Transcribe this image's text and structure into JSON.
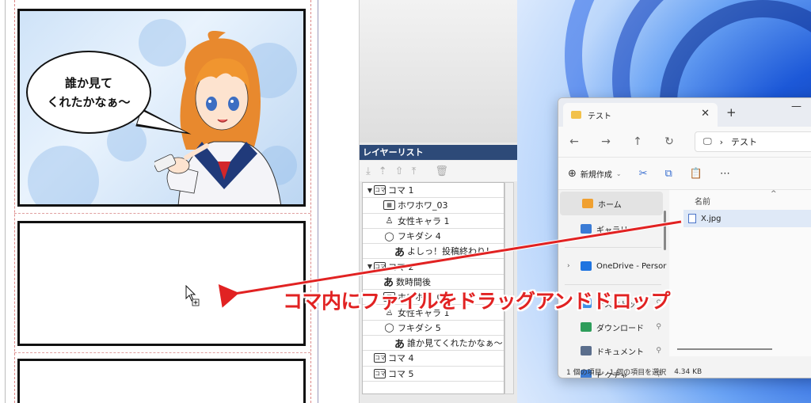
{
  "canvas": {
    "speech_line1": "誰か見て",
    "speech_line2": "くれたかなぁ～"
  },
  "layer_panel": {
    "title": "レイヤーリスト",
    "tool_icons": [
      "download-icon",
      "merge-icon",
      "move-up-icon",
      "move-top-icon",
      "trash-icon"
    ],
    "layers": [
      {
        "level": 1,
        "type": "koma",
        "label": "コマ 1",
        "expanded": true
      },
      {
        "level": 2,
        "type": "image",
        "label": "ホワホワ_03"
      },
      {
        "level": 2,
        "type": "character",
        "label": "女性キャラ 1"
      },
      {
        "level": 2,
        "type": "balloon",
        "label": "フキダシ 4"
      },
      {
        "level": 3,
        "type": "text",
        "label": "よしっ！投稿終わり！"
      },
      {
        "level": 1,
        "type": "koma",
        "label": "コマ 2",
        "expanded": true
      },
      {
        "level": 2,
        "type": "text",
        "label": "数時間後"
      },
      {
        "level": 2,
        "type": "image",
        "label": "ホワホワ_02"
      },
      {
        "level": 2,
        "type": "character",
        "label": "女性キャラ 1"
      },
      {
        "level": 2,
        "type": "balloon",
        "label": "フキダシ 5"
      },
      {
        "level": 3,
        "type": "text",
        "label": "誰か見てくれたかなぁ～"
      },
      {
        "level": 1,
        "type": "koma",
        "label": "コマ 4"
      },
      {
        "level": 1,
        "type": "koma",
        "label": "コマ 5"
      }
    ]
  },
  "explorer": {
    "tab_title": "テスト",
    "address_folder": "テスト",
    "new_label": "新規作成",
    "nav_items": [
      {
        "label": "ホーム",
        "icon": "home-icon",
        "selected": true,
        "pinned": false,
        "chevron": false
      },
      {
        "label": "ギャラリー",
        "icon": "gallery-icon",
        "selected": false,
        "pinned": false,
        "chevron": false
      },
      {
        "label": "OneDrive - Persor",
        "icon": "cloud-icon",
        "selected": false,
        "pinned": false,
        "chevron": true
      },
      {
        "label": "デスクトップ",
        "icon": "desktop-icon",
        "selected": false,
        "pinned": true,
        "chevron": false
      },
      {
        "label": "ダウンロード",
        "icon": "download-icon",
        "selected": false,
        "pinned": true,
        "chevron": false
      },
      {
        "label": "ドキュメント",
        "icon": "document-icon",
        "selected": false,
        "pinned": true,
        "chevron": false
      },
      {
        "label": "ピクチャ",
        "icon": "picture-icon",
        "selected": false,
        "pinned": true,
        "chevron": false
      }
    ],
    "column_name": "名前",
    "file_name": "X.jpg",
    "status_count": "1 個の項目",
    "status_selected": "1 個の項目を選択",
    "status_size": "4.34 KB"
  },
  "annotation": {
    "text": "コマ内にファイルをドラッグアンドドロップ",
    "color": "#e12222"
  }
}
